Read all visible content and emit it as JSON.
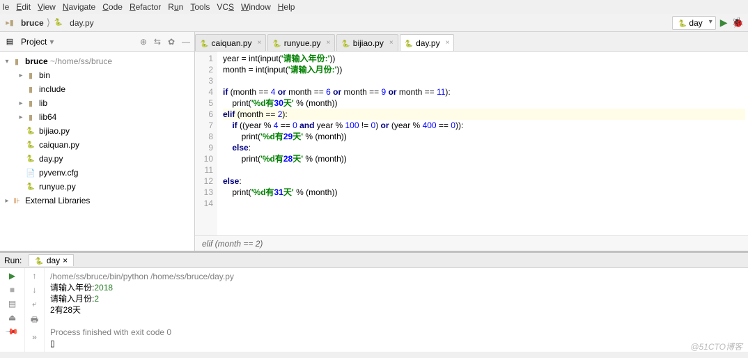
{
  "menu": [
    "le",
    "Edit",
    "View",
    "Navigate",
    "Code",
    "Refactor",
    "Run",
    "Tools",
    "VCS",
    "Window",
    "Help"
  ],
  "breadcrumb": {
    "root": "bruce",
    "file": "day.py"
  },
  "runconfig": "day",
  "sidebar": {
    "title": "Project",
    "tree": {
      "root": {
        "name": "bruce",
        "path": "~/home/ss/bruce"
      },
      "children": [
        {
          "type": "dir",
          "name": "bin",
          "expand": true,
          "arrow": "▸"
        },
        {
          "type": "dir",
          "name": "include",
          "expand": false,
          "arrow": ""
        },
        {
          "type": "dir",
          "name": "lib",
          "expand": true,
          "arrow": "▸"
        },
        {
          "type": "dir",
          "name": "lib64",
          "expand": true,
          "arrow": "▸"
        },
        {
          "type": "py",
          "name": "bijiao.py"
        },
        {
          "type": "py",
          "name": "caiquan.py"
        },
        {
          "type": "py",
          "name": "day.py"
        },
        {
          "type": "cfg",
          "name": "pyvenv.cfg"
        },
        {
          "type": "py",
          "name": "runyue.py"
        }
      ],
      "external": "External Libraries"
    }
  },
  "tabs": [
    {
      "label": "caiquan.py",
      "active": false
    },
    {
      "label": "runyue.py",
      "active": false
    },
    {
      "label": "bijiao.py",
      "active": false
    },
    {
      "label": "day.py",
      "active": true
    }
  ],
  "code": {
    "maxline": 14,
    "lines": [
      "year = int(input('请输入年份:'))",
      "month = int(input('请输入月份:'))",
      "",
      "if (month == 4 or month == 6 or month == 9 or month == 11):",
      "    print('%d有30天' % (month))",
      "elif (month == 2):",
      "    if ((year % 4 == 0 and year % 100 != 0) or (year % 400 == 0)):",
      "        print('%d有29天' % (month))",
      "    else:",
      "        print('%d有28天' % (month))",
      "",
      "else:",
      "    print('%d有31天' % (month))",
      ""
    ]
  },
  "crumb": "elif (month == 2)",
  "run": {
    "label": "Run:",
    "tab": "day",
    "cmd": "/home/ss/bruce/bin/python /home/ss/bruce/day.py",
    "line1a": "请输入年份:",
    "line1b": "2018",
    "line2a": "请输入月份:",
    "line2b": "2",
    "out": "2有28天",
    "exit": "Process finished with exit code 0"
  },
  "watermark": "@51CTO博客"
}
